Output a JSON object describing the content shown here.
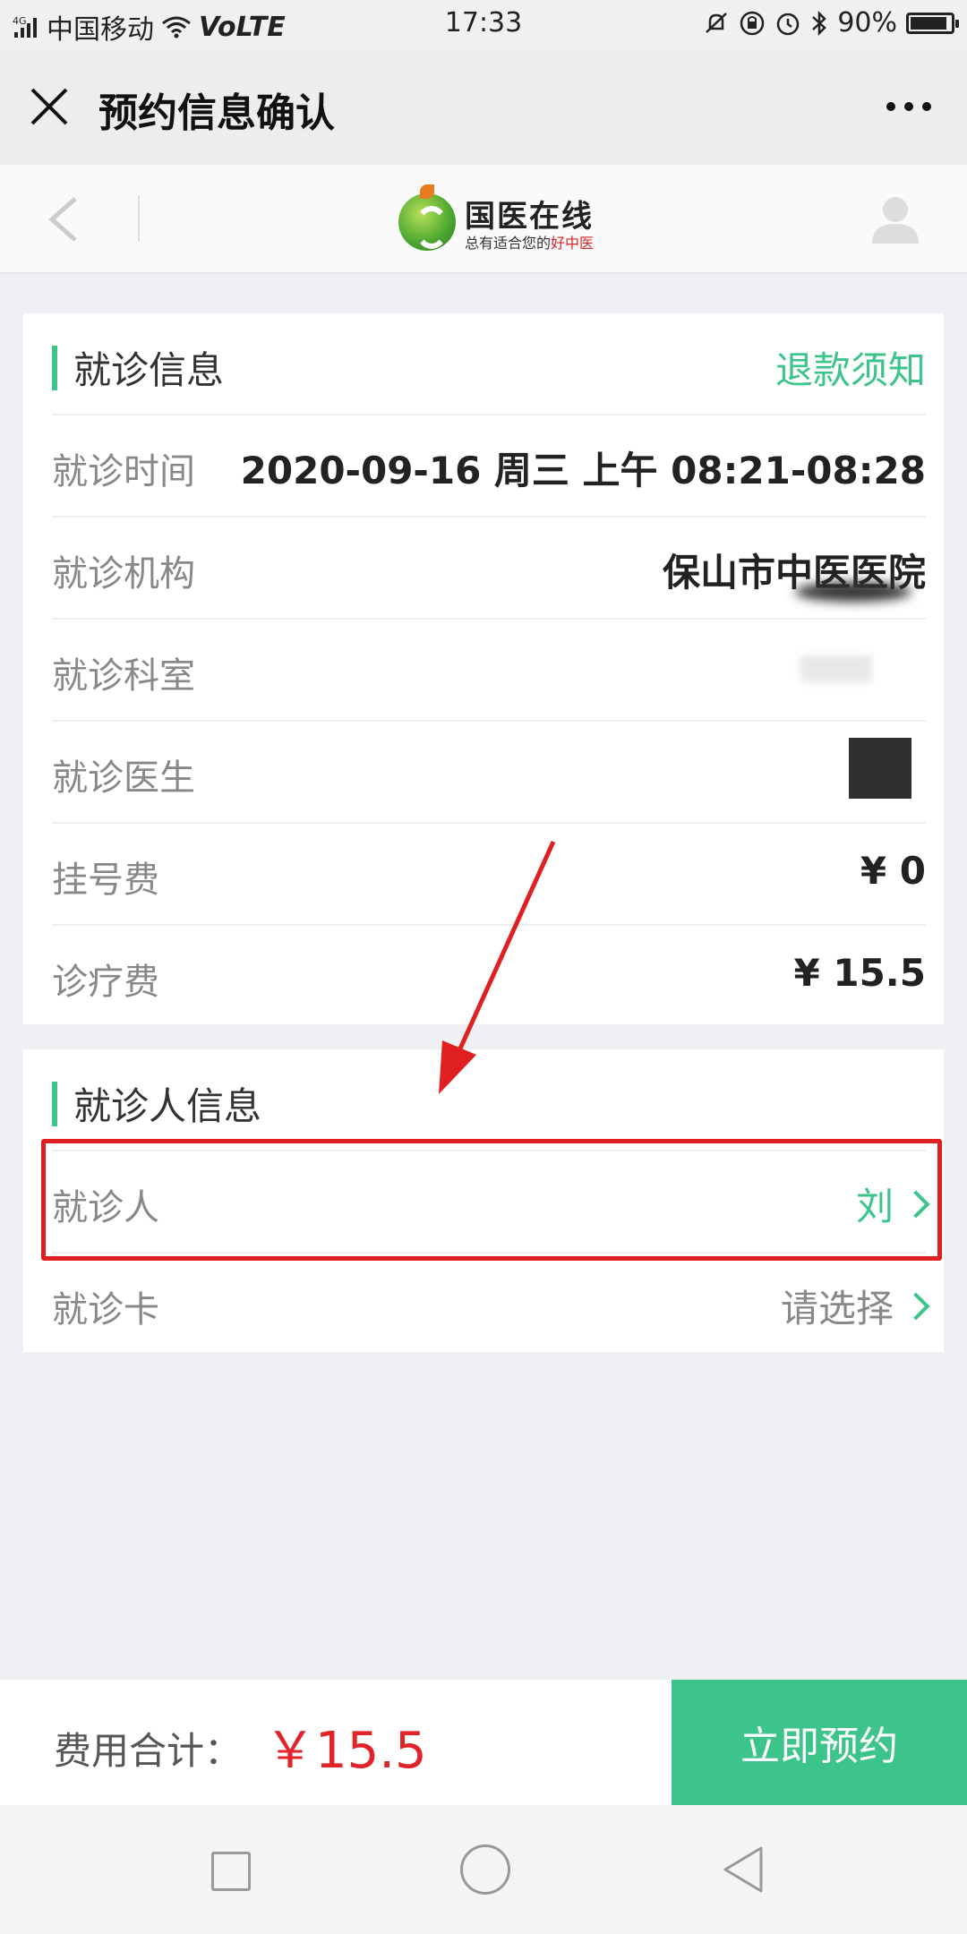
{
  "status_bar": {
    "network": "4G",
    "carrier": "中国移动",
    "volte": "VoLTE",
    "time": "17:33",
    "battery": "90%",
    "battery_level": 0.9,
    "icons": [
      "signal-icon",
      "wifi-icon",
      "mute-icon",
      "rotation-lock-icon",
      "alarm-icon",
      "bluetooth-icon",
      "battery-icon"
    ]
  },
  "titlebar": {
    "title": "预约信息确认",
    "close_icon": "close-icon",
    "more_icon": "more-icon"
  },
  "app_header": {
    "logo_name": "国医在线",
    "logo_slogan_prefix": "总有适合您的",
    "logo_slogan_highlight": "好中医",
    "back_icon": "back-chevron-icon",
    "user_icon": "user-avatar-icon"
  },
  "visit_info": {
    "title": "就诊信息",
    "refund_link": "退款须知",
    "rows": [
      {
        "label": "就诊时间",
        "value": "2020-09-16 周三 上午 08:21-08:28"
      },
      {
        "label": "就诊机构",
        "value": "保山市中医医院"
      },
      {
        "label": "就诊科室",
        "value": ""
      },
      {
        "label": "就诊医生",
        "value": ""
      },
      {
        "label": "挂号费",
        "value": "¥ 0"
      },
      {
        "label": "诊疗费",
        "value": "¥ 15.5"
      }
    ]
  },
  "patient_info": {
    "title": "就诊人信息",
    "rows": [
      {
        "label": "就诊人",
        "value": "刘"
      },
      {
        "label": "就诊卡",
        "value": "请选择"
      }
    ]
  },
  "footer": {
    "total_label": "费用合计：",
    "total_amount": "￥15.5",
    "book_button": "立即预约"
  },
  "colors": {
    "accent": "#3cc48a",
    "price_red": "#e0242a",
    "highlight_red": "#e02020"
  }
}
